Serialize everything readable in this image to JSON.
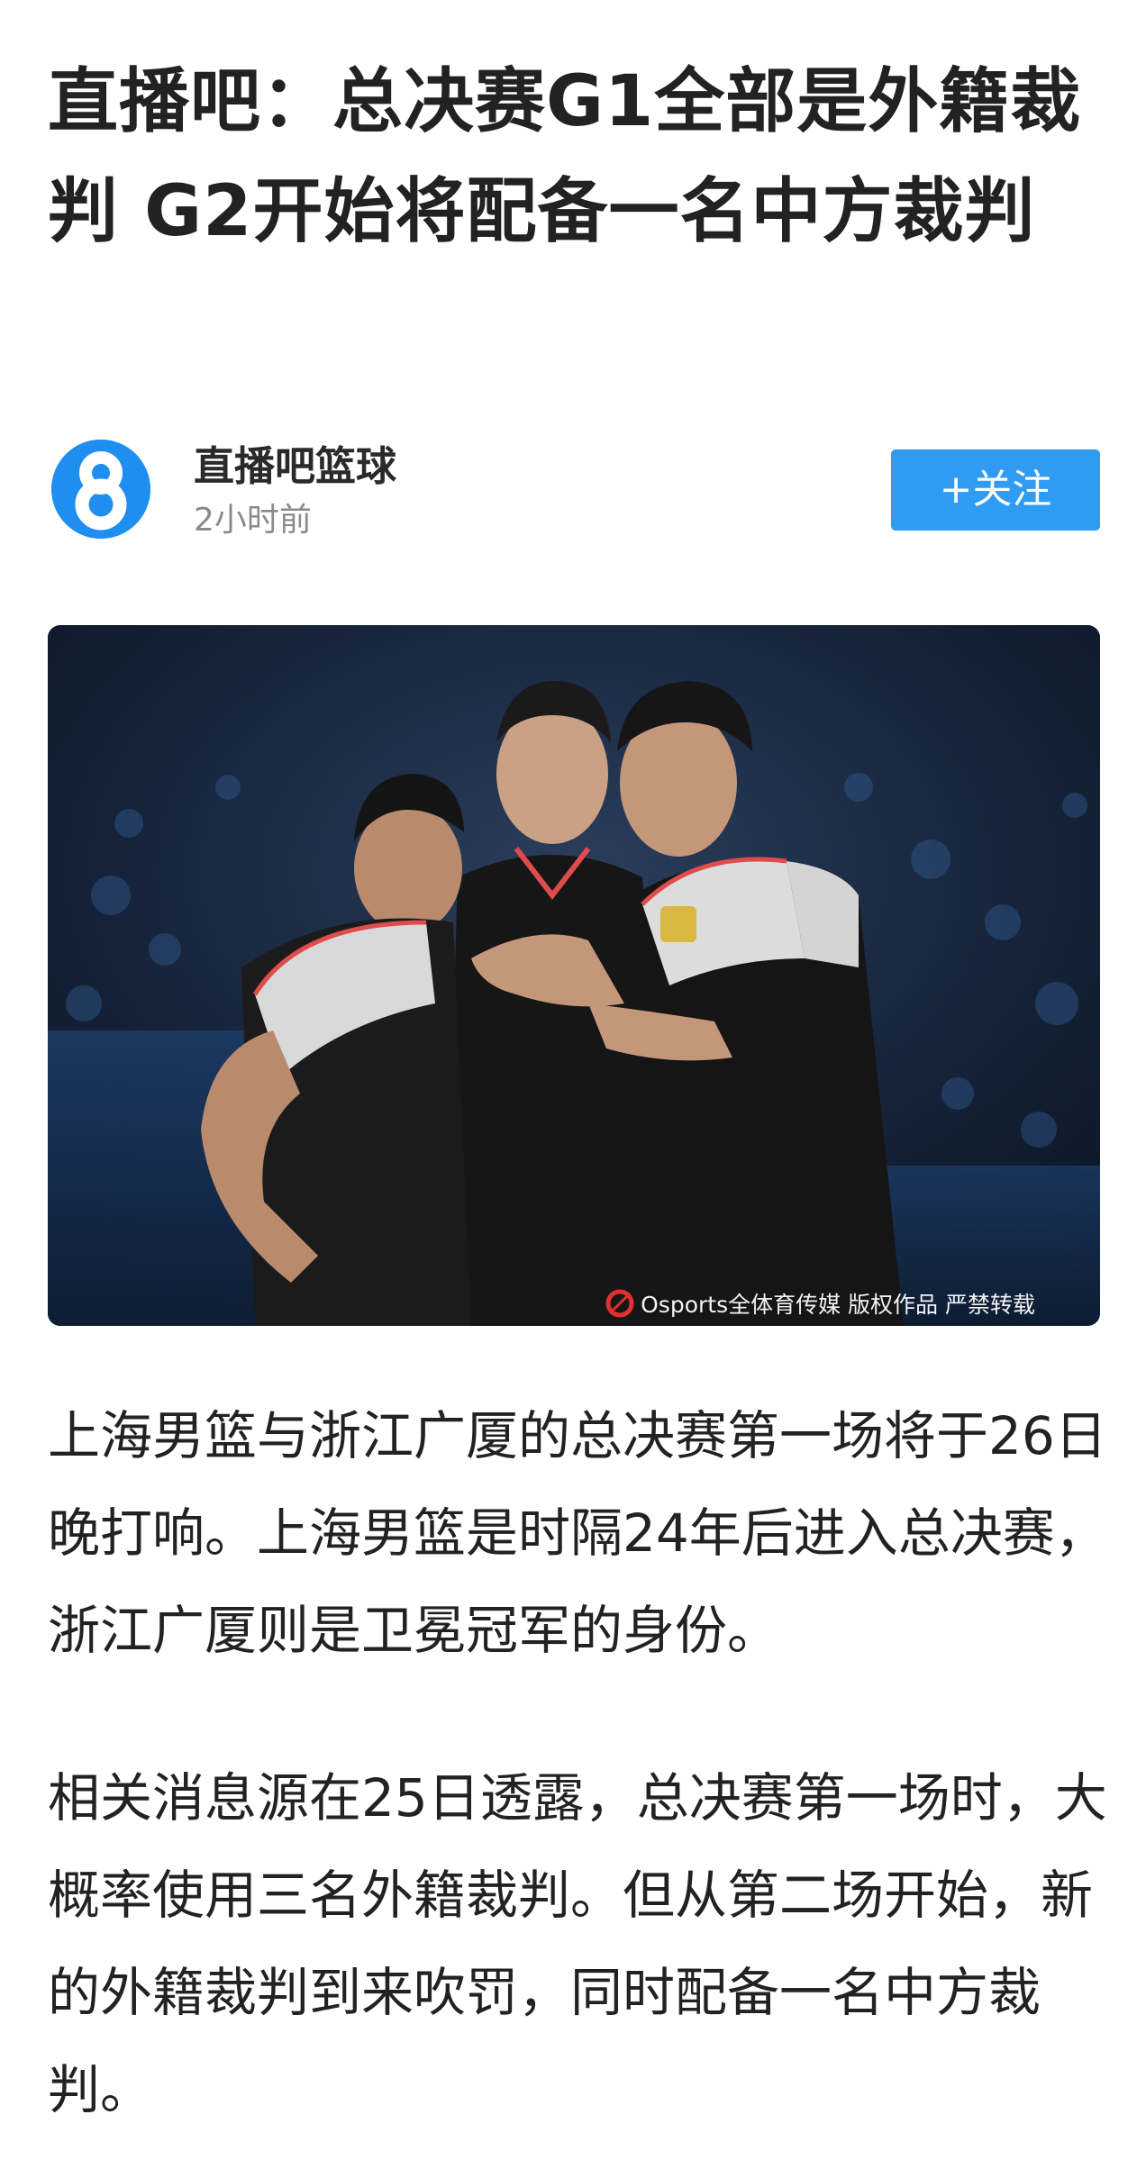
{
  "article": {
    "title": "直播吧：总决赛G1全部是外籍裁判 G2开始将配备一名中方裁判",
    "author": {
      "name": "直播吧篮球",
      "time": "2小时前",
      "avatar_icon": "zhibo8-logo-icon",
      "follow_label": "+关注"
    },
    "photo": {
      "watermark": "Osports全体育传媒 版权作品 严禁转载"
    },
    "paragraphs": [
      "上海男篮与浙江广厦的总决赛第一场将于26日晚打响。上海男篮是时隔24年后进入总决赛，浙江广厦则是卫冕冠军的身份。",
      "相关消息源在25日透露，总决赛第一场时，大概率使用三名外籍裁判。但从第二场开始，新的外籍裁判到来吹罚，同时配备一名中方裁判。"
    ]
  },
  "colors": {
    "accent": "#2f9bf2",
    "title_text": "#222222",
    "secondary_text": "#8a8a8a",
    "background": "#ffffff"
  }
}
